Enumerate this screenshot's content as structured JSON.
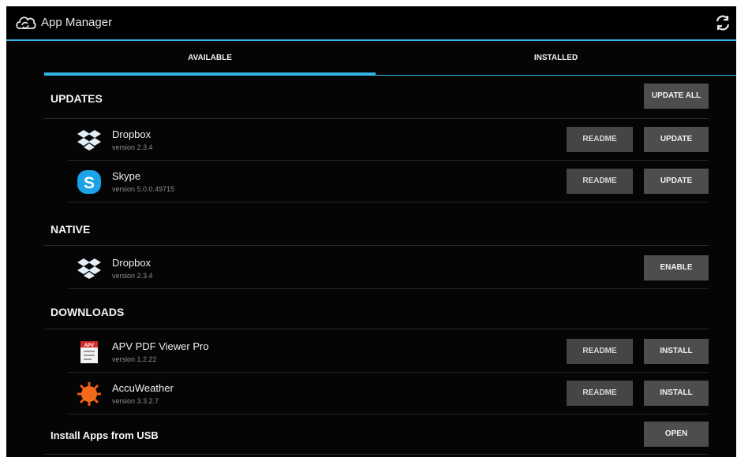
{
  "actionbar": {
    "title": "App Manager",
    "app_icon": "cloud-sync-icon",
    "refresh_icon": "refresh-icon"
  },
  "tabs": [
    {
      "label": "AVAILABLE",
      "selected": true
    },
    {
      "label": "INSTALLED",
      "selected": false
    }
  ],
  "colors": {
    "accent": "#33b5e5",
    "background": "#050505",
    "button": "#4a4a4a"
  },
  "sections": {
    "updates": {
      "title": "UPDATES",
      "action_label": "UPDATE ALL",
      "items": [
        {
          "name": "Dropbox",
          "version": "version 2.3.4",
          "icon": "dropbox-icon",
          "readme_label": "README",
          "action_label": "UPDATE"
        },
        {
          "name": "Skype",
          "version": "version 5.0.0.49715",
          "icon": "skype-icon",
          "readme_label": "README",
          "action_label": "UPDATE"
        }
      ]
    },
    "native": {
      "title": "NATIVE",
      "items": [
        {
          "name": "Dropbox",
          "version": "version 2.3.4",
          "icon": "dropbox-icon",
          "action_label": "ENABLE"
        }
      ]
    },
    "downloads": {
      "title": "DOWNLOADS",
      "items": [
        {
          "name": "APV PDF Viewer Pro",
          "version": "version 1.2.22",
          "icon": "pdf-icon",
          "readme_label": "README",
          "action_label": "INSTALL"
        },
        {
          "name": "AccuWeather",
          "version": "version 3.3.2.7",
          "icon": "sun-icon",
          "readme_label": "README",
          "action_label": "INSTALL"
        }
      ]
    },
    "usb": {
      "title": "Install Apps from USB",
      "action_label": "OPEN"
    }
  }
}
